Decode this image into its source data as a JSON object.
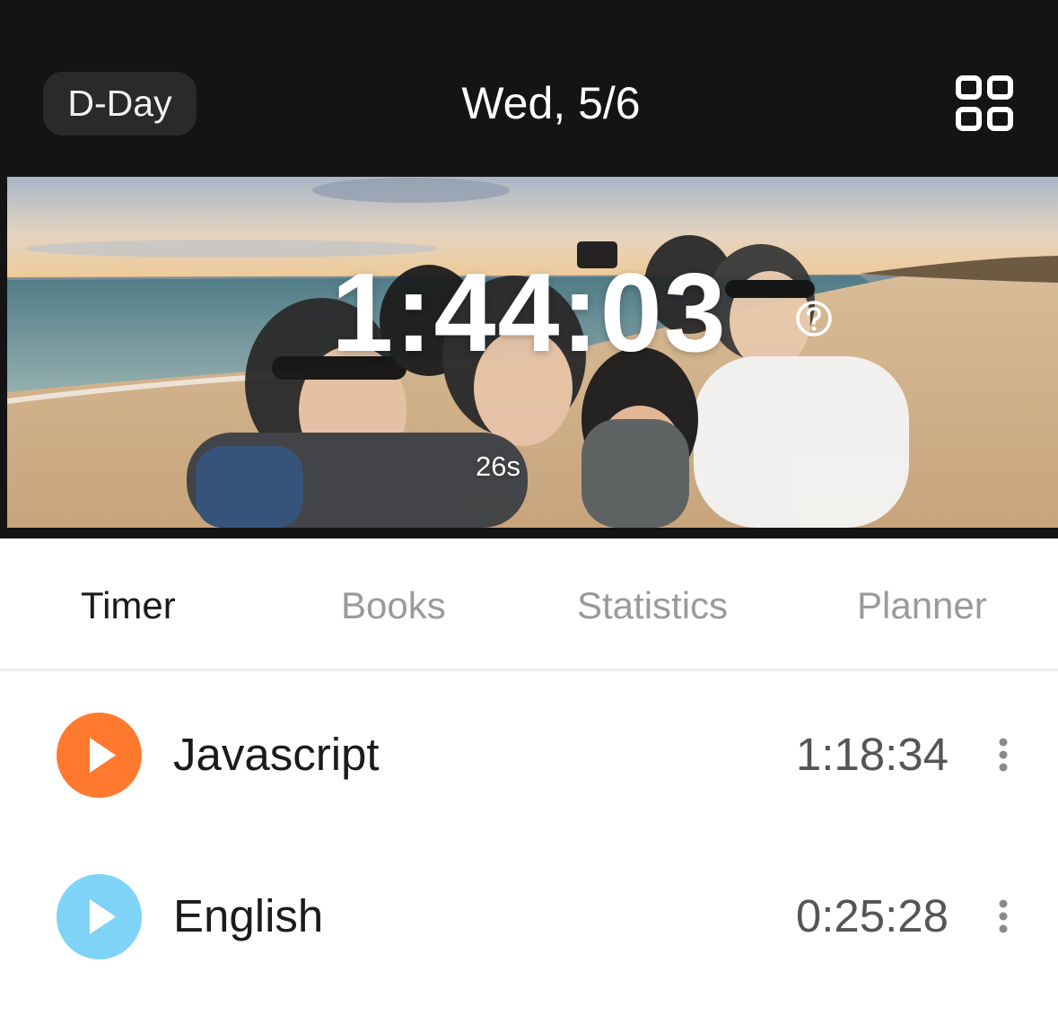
{
  "header": {
    "dday_label": "D-Day",
    "date": "Wed, 5/6",
    "menu_icon": "grid-icon"
  },
  "banner": {
    "timer": "1:44:03",
    "seconds": "26s",
    "help_icon": "question-circle-icon"
  },
  "tabs": [
    {
      "label": "Timer",
      "active": true
    },
    {
      "label": "Books",
      "active": false
    },
    {
      "label": "Statistics",
      "active": false
    },
    {
      "label": "Planner",
      "active": false
    }
  ],
  "subjects": [
    {
      "name": "Javascript",
      "time": "1:18:34",
      "color": "#ff7a2f",
      "icon": "play-icon"
    },
    {
      "name": "English",
      "time": "0:25:28",
      "color": "#7fd3f7",
      "icon": "play-icon"
    }
  ],
  "colors": {
    "header_bg": "#141414",
    "accent_orange": "#ff7a2f",
    "accent_blue": "#7fd3f7"
  }
}
